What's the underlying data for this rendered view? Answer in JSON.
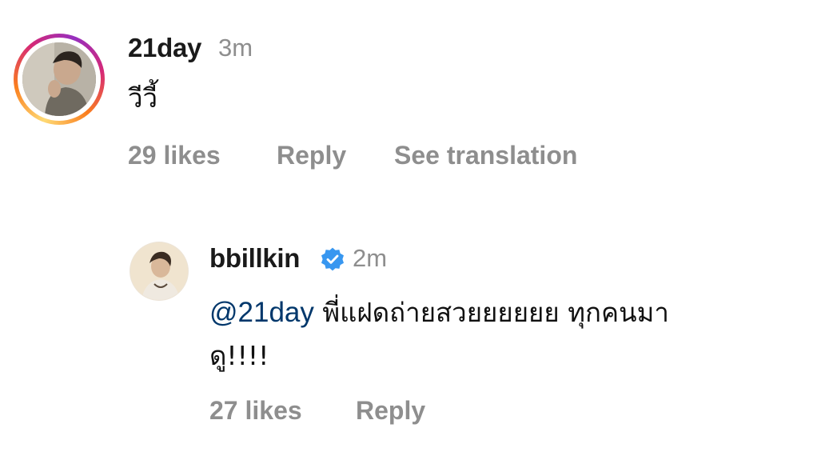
{
  "comments": [
    {
      "username": "21day",
      "time": "3m",
      "text": "วีวี้",
      "likes": "29 likes",
      "reply_label": "Reply",
      "translation_label": "See translation",
      "avatar_ring": "instagram-story-gradient"
    }
  ],
  "reply": {
    "username": "bbillkin",
    "verified": true,
    "time": "2m",
    "mention": "@21day",
    "text_line1": " พี่แฝดถ่ายสวยยยยยย ทุกคนมา",
    "text_line2": "ดู!!!!",
    "likes": "27 likes",
    "reply_label": "Reply"
  },
  "colors": {
    "mention": "#00376b",
    "secondary_text": "#8e8e8e",
    "verified_badge": "#3897f0"
  }
}
